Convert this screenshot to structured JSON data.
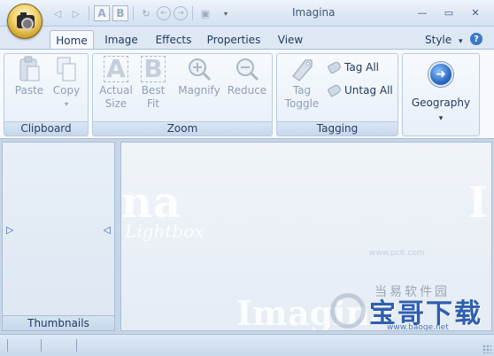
{
  "window": {
    "title": "Imagina"
  },
  "quick_access": {
    "items": [
      {
        "name": "back-icon",
        "glyph": "◁"
      },
      {
        "name": "forward-icon",
        "glyph": "▷"
      },
      {
        "name": "actual-size-icon",
        "glyph": "A"
      },
      {
        "name": "best-fit-icon",
        "glyph": "B"
      },
      {
        "name": "rotate-icon",
        "glyph": "↻"
      },
      {
        "name": "prev-icon",
        "glyph": "←"
      },
      {
        "name": "next-icon",
        "glyph": "→"
      },
      {
        "name": "save-icon",
        "glyph": "▣"
      }
    ]
  },
  "tabs": [
    {
      "label": "Home",
      "active": true
    },
    {
      "label": "Image"
    },
    {
      "label": "Effects"
    },
    {
      "label": "Properties"
    },
    {
      "label": "View"
    }
  ],
  "style_menu": {
    "label": "Style",
    "arrow": "▾"
  },
  "ribbon": {
    "clipboard": {
      "label": "Clipboard",
      "paste": "Paste",
      "copy": "Copy"
    },
    "zoom": {
      "label": "Zoom",
      "actual_size": "Actual\nSize",
      "best_fit": "Best\nFit",
      "magnify": "Magnify",
      "reduce": "Reduce"
    },
    "tagging": {
      "label": "Tagging",
      "tag_toggle": "Tag\nToggle",
      "tag_all": "Tag All",
      "untag_all": "Untag All"
    },
    "geography": {
      "label": "Geography",
      "arrow": "▾"
    }
  },
  "left_pane": {
    "label": "Thumbnails"
  },
  "watermark": {
    "brand": "Imagina",
    "left_fragment": "na",
    "right_fragment": "I",
    "sub": "Lightbox",
    "site_small": "当易软件园",
    "site_url": "www.pc6.com",
    "site_logo": "宝哥下载",
    "site_url2": "www.baoge.net"
  },
  "colors": {
    "accent": "#3b79c8",
    "ribbon_bg": "#f6f9fd",
    "frame": "#c6d6e8"
  }
}
